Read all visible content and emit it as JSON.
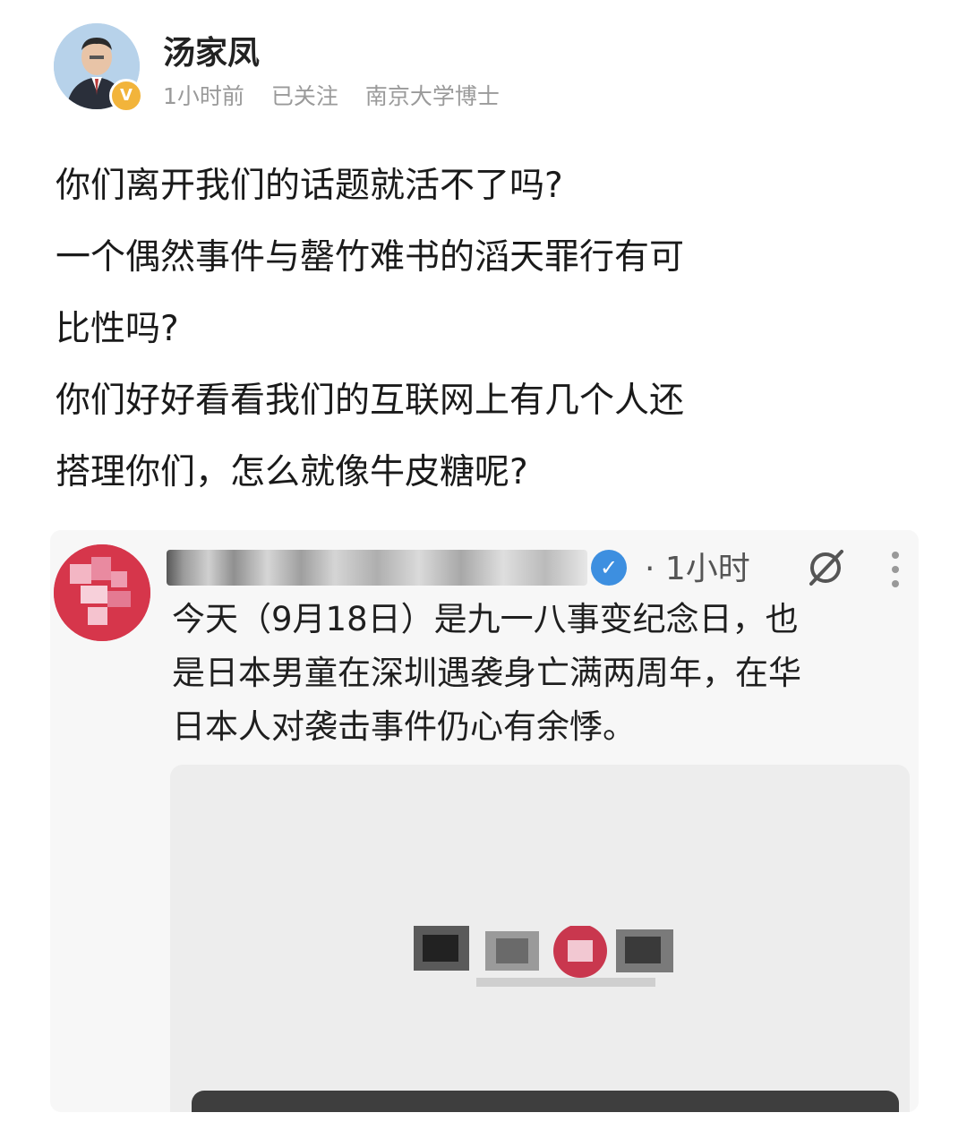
{
  "post": {
    "author_name": "汤家凤",
    "verified_badge": "V",
    "time": "1小时前",
    "follow_status": "已关注",
    "author_title": "南京大学博士",
    "body_lines": [
      "你们离开我们的话题就活不了吗?",
      "一个偶然事件与罄竹难书的滔天罪行有可",
      "比性吗?",
      "你们好好看看我们的互联网上有几个人还",
      "搭理你们，怎么就像牛皮糖呢?"
    ]
  },
  "quoted": {
    "time": "· 1小时",
    "verified_icon": "✓",
    "text_lines": [
      "今天（9月18日）是九一八事变纪念日，也",
      "是日本男童在深圳遇袭身亡满两周年，在华",
      "日本人对袭击事件仍心有余悸。"
    ]
  },
  "icons": {
    "avatar": "person-photo",
    "verified": "check-badge-icon",
    "slash": "hidden-slash-icon",
    "more": "more-vertical-icon"
  },
  "colors": {
    "badge_gold": "#f2b43b",
    "verified_blue": "#3d8fe0",
    "meta_gray": "#9a9a9a",
    "quoted_avatar_red": "#d6364b"
  }
}
